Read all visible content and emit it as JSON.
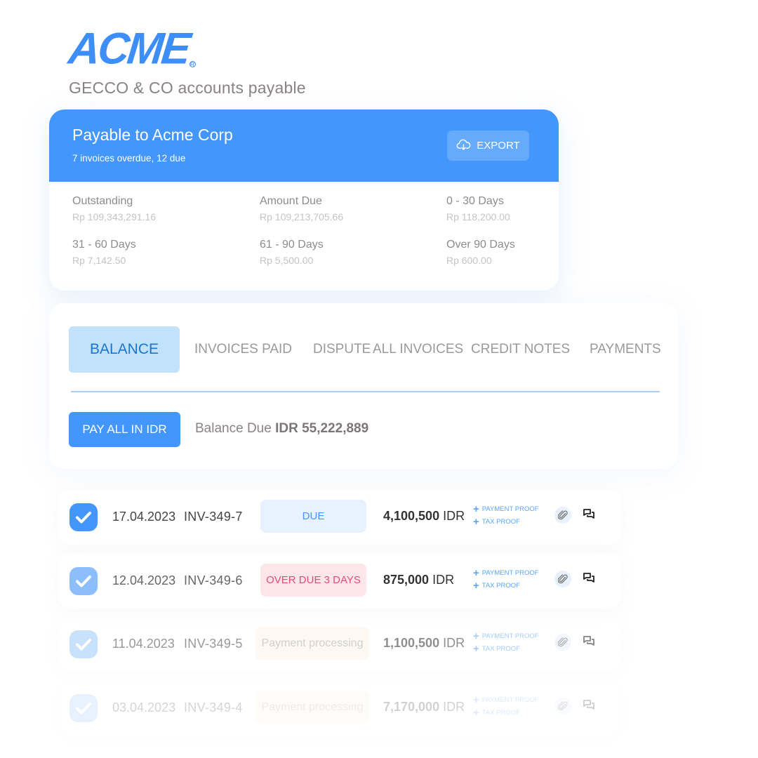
{
  "brand": {
    "logo_text": "ACME",
    "logo_reg": "R",
    "subtitle": "GECCO & CO accounts payable",
    "accent_color": "#4396fb"
  },
  "summary": {
    "title": "Payable to Acme Corp",
    "subtitle": "7 invoices overdue, 12 due",
    "export_label": "EXPORT",
    "export_icon": "cloud-download-icon",
    "stats": [
      {
        "label": "Outstanding",
        "value": "Rp 109,343,291.16"
      },
      {
        "label": "Amount Due",
        "value": "Rp 109,213,705.66"
      },
      {
        "label": "0 - 30 Days",
        "value": "Rp 118,200.00"
      },
      {
        "label": "31 - 60 Days",
        "value": "Rp 7,142.50"
      },
      {
        "label": "61 - 90 Days",
        "value": "Rp 5,500.00"
      },
      {
        "label": "Over 90 Days",
        "value": "Rp 600.00"
      }
    ]
  },
  "tabs": [
    {
      "label": "BALANCE",
      "active": true
    },
    {
      "label": "INVOICES PAID",
      "active": false
    },
    {
      "label": "DISPUTE",
      "active": false
    },
    {
      "label": "ALL INVOICES",
      "active": false
    },
    {
      "label": "CREDIT NOTES",
      "active": false
    },
    {
      "label": "PAYMENTS",
      "active": false
    }
  ],
  "balance": {
    "pay_all_label": "PAY ALL IN IDR",
    "balance_due_label": "Balance Due",
    "balance_due_value": "IDR 55,222,889"
  },
  "invoices": [
    {
      "checked": true,
      "date": "17.04.2023",
      "number": "INV-349-7",
      "status": "DUE",
      "amount": "4,100,500",
      "currency": "IDR",
      "payment_proof": "PAYMENT PROOF",
      "tax_proof": "TAX PROOF"
    },
    {
      "checked": true,
      "date": "12.04.2023",
      "number": "INV-349-6",
      "status": "OVER DUE 3 DAYS",
      "amount": "875,000",
      "currency": "IDR",
      "payment_proof": "PAYMENT PROOF",
      "tax_proof": "TAX PROOF"
    },
    {
      "checked": true,
      "date": "11.04.2023",
      "number": "INV-349-5",
      "status": "Payment processing",
      "amount": "1,100,500",
      "currency": "IDR",
      "payment_proof": "PAYMENT PROOF",
      "tax_proof": "TAX PROOF"
    },
    {
      "checked": true,
      "date": "03.04.2023",
      "number": "INV-349-4",
      "status": "Payment processing",
      "amount": "7,170,000",
      "currency": "IDR",
      "payment_proof": "PAYMENT PROOF",
      "tax_proof": "TAX PROOF"
    }
  ],
  "status_colors": {
    "due_text": "#4396fb",
    "due_bg": "#e6f2fe",
    "overdue_text": "#e54a7d",
    "overdue_bg": "#fde6ea",
    "processing_bg": "#fdf4e8"
  }
}
